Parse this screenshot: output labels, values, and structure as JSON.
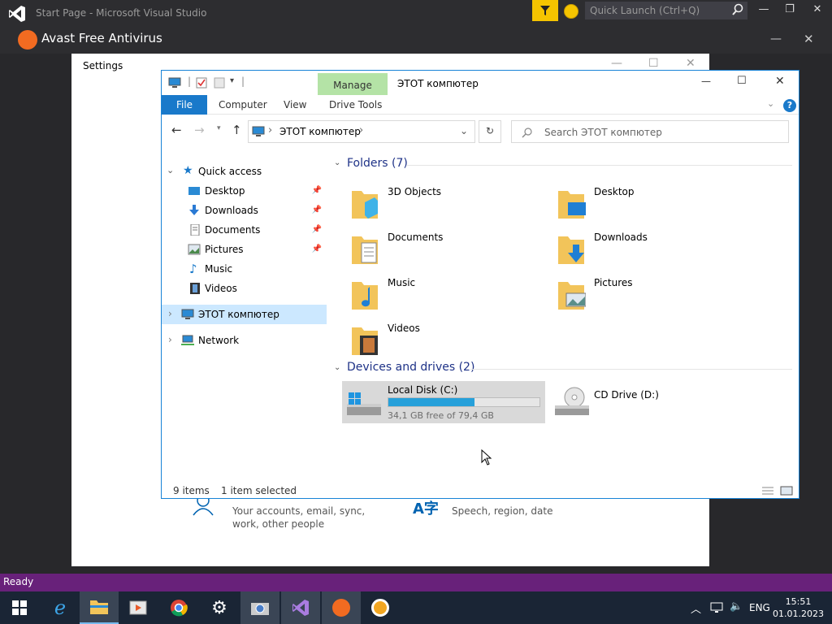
{
  "vs": {
    "title": "Start Page - Microsoft Visual Studio",
    "quick_launch_placeholder": "Quick Launch (Ctrl+Q)",
    "status": "Ready"
  },
  "avast": {
    "title": "Avast Free Antivirus"
  },
  "settings": {
    "title": "Settings",
    "accounts_line1": "Your accounts, email, sync,",
    "accounts_line2": "work, other people",
    "language_line1": "Speech, region, date"
  },
  "explorer": {
    "title": "ЭТОТ компютер",
    "manage_tab": "Manage",
    "ribbon_tabs": [
      "File",
      "Computer",
      "View",
      "Drive Tools"
    ],
    "address": "ЭТОТ компютер",
    "search_placeholder": "Search ЭТОТ компютер",
    "nav": {
      "quick_access": "Quick access",
      "items": [
        "Desktop",
        "Downloads",
        "Documents",
        "Pictures",
        "Music",
        "Videos"
      ],
      "this_pc": "ЭТОТ компютер",
      "network": "Network"
    },
    "folders_header": "Folders (7)",
    "folders": [
      "3D Objects",
      "Desktop",
      "Documents",
      "Downloads",
      "Music",
      "Pictures",
      "Videos"
    ],
    "devices_header": "Devices and drives (2)",
    "drives": [
      {
        "name": "Local Disk (C:)",
        "free": "34,1 GB free of 79,4 GB",
        "used_fraction": 0.57
      },
      {
        "name": "CD Drive (D:)"
      }
    ],
    "status_items": "9 items",
    "status_selected": "1 item selected"
  },
  "taskbar": {
    "language": "ENG",
    "time": "15:51",
    "date": "01.01.2023"
  },
  "colors": {
    "accent": "#1979ca",
    "manage": "#b4e3a6",
    "vs_status": "#68217a",
    "avast": "#f26b21"
  }
}
